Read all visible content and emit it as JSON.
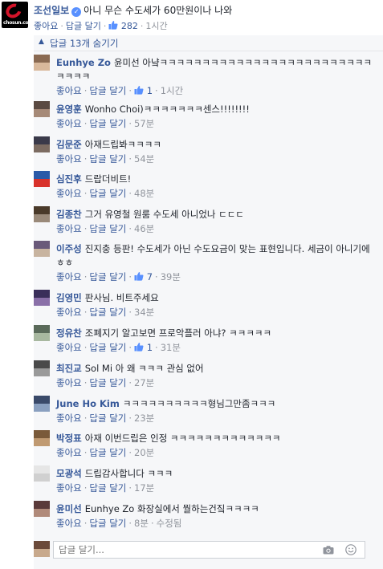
{
  "post": {
    "logo_text": "chosun.com",
    "author": "조선일보",
    "text": "아니 무슨 수도세가 60만원이나 나와",
    "like": "좋아요",
    "reply": "답글 달기",
    "likes": "282",
    "time": "1시간"
  },
  "hide_replies": "답글 13개 숨기기",
  "comments": [
    {
      "name": "Eunhye Zo",
      "text": "윤미선 아냨ㅋㅋㅋㅋㅋㅋㅋㅋㅋㅋㅋㅋㅋㅋㅋㅋㅋㅋㅋㅋㅋㅋㅋㅋㅋㅋㅋㅋㅋ",
      "like": "좋아요",
      "reply": "답글 달기",
      "likes": "1",
      "time": "1시간"
    },
    {
      "name": "윤영훈",
      "text": "Wonho Choi)ㅋㅋㅋㅋㅋㅋㅋ센스!!!!!!!!",
      "like": "좋아요",
      "reply": "답글 달기",
      "likes": "",
      "time": "57분"
    },
    {
      "name": "김문준",
      "text": "아재드립봐ㅋㅋㅋㅋ",
      "like": "좋아요",
      "reply": "답글 달기",
      "likes": "",
      "time": "54분"
    },
    {
      "name": "심진후",
      "text": "드랍더비트!",
      "like": "좋아요",
      "reply": "답글 달기",
      "likes": "",
      "time": "48분"
    },
    {
      "name": "김종찬",
      "text": "그거 유영철 원룸 수도세 아니었나 ㄷㄷㄷ",
      "like": "좋아요",
      "reply": "답글 달기",
      "likes": "",
      "time": "46분"
    },
    {
      "name": "이주성",
      "text": "진지충 등판! 수도세가 아닌 수도요금이 맞는 표현입니다. 세금이 아니기에 ㅎㅎ",
      "like": "좋아요",
      "reply": "답글 달기",
      "likes": "7",
      "time": "39분"
    },
    {
      "name": "김영민",
      "text": "판사님. 비트주세요",
      "like": "좋아요",
      "reply": "답글 달기",
      "likes": "",
      "time": "34분"
    },
    {
      "name": "정유찬",
      "text": "조폐지기 알고보면 프로악플러 아냐? ㅋㅋㅋㅋㅋ",
      "like": "좋아요",
      "reply": "답글 달기",
      "likes": "1",
      "time": "31분"
    },
    {
      "name": "최진교",
      "text": "Sol Mi 아 왜 ㅋㅋㅋ 관심 없어",
      "like": "좋아요",
      "reply": "답글 달기",
      "likes": "",
      "time": "27분"
    },
    {
      "name": "June Ho Kim",
      "text": "ㅋㅋㅋㅋㅋㅋㅋㅋㅋㅋ형님그만좀ㅋㅋㅋ",
      "like": "좋아요",
      "reply": "답글 달기",
      "likes": "",
      "time": "23분"
    },
    {
      "name": "박정표",
      "text": "아재 이번드립은 인정 ㅋㅋㅋㅋㅋㅋㅋㅋㅋㅋㅋㅋㅋ",
      "like": "좋아요",
      "reply": "답글 달기",
      "likes": "",
      "time": "20분"
    },
    {
      "name": "모광석",
      "text": "드립감사합니다 ㅋㅋㅋ",
      "like": "좋아요",
      "reply": "답글 달기",
      "likes": "",
      "time": "17분"
    },
    {
      "name": "윤미선",
      "text": "Eunhye Zo 화장실에서 뭘하는건짘ㅋㅋㅋㅋ",
      "like": "좋아요",
      "reply": "답글 달기",
      "likes": "",
      "time": "8분",
      "edited": "수정됨"
    }
  ],
  "reply_box": {
    "placeholder": "답글 달기..."
  },
  "colors": {
    "link": "#365899",
    "meta": "#90949c",
    "bg": "#f6f7f9",
    "brand": "#d4142a"
  }
}
